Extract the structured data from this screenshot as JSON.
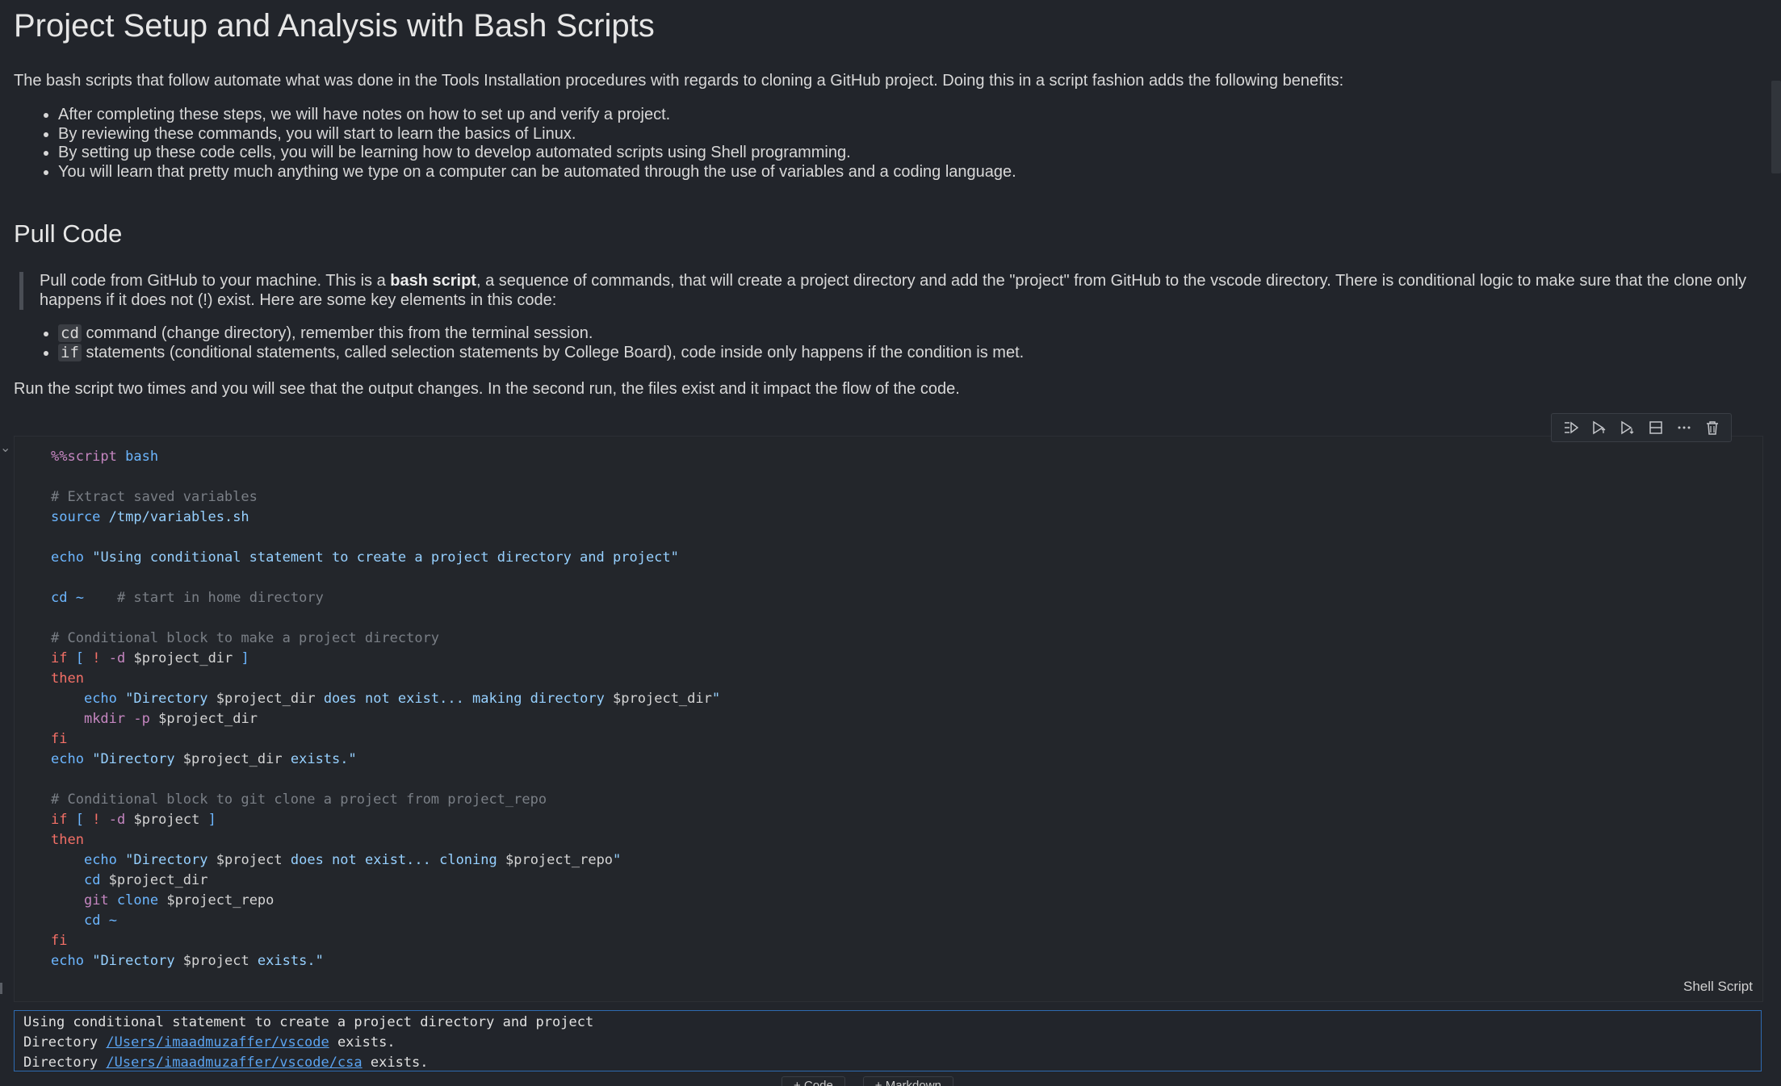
{
  "title": "Project Setup and Analysis with Bash Scripts",
  "intro": "The bash scripts that follow automate what was done in the Tools Installation procedures with regards to cloning a GitHub project. Doing this in a script fashion adds the following benefits:",
  "benefits": [
    "After completing these steps, we will have notes on how to set up and verify a project.",
    "By reviewing these commands, you will start to learn the basics of Linux.",
    "By setting up these code cells, you will be learning how to develop automated scripts using Shell programming.",
    "You will learn that pretty much anything we type on a computer can be automated through the use of variables and a coding language."
  ],
  "section_heading": "Pull Code",
  "quote": {
    "before": "Pull code from GitHub to your machine. This is a ",
    "bold": "bash script",
    "after": ", a sequence of commands, that will create a project directory and add the \"project\" from GitHub to the vscode directory. There is conditional logic to make sure that the clone only happens if it does not (!) exist. Here are some key elements in this code:"
  },
  "key_elements": [
    {
      "code": "cd",
      "text": " command (change directory), remember this from the terminal session."
    },
    {
      "code": "if",
      "text": " statements (conditional statements, called selection statements by College Board), code inside only happens if the condition is met."
    }
  ],
  "run_note": "Run the script two times and you will see that the output changes. In the second run, the files exist and it impact the flow of the code.",
  "cell": {
    "language": "Shell Script",
    "toolbar_icons": [
      "run-by-line-icon",
      "run-above-icon",
      "run-below-icon",
      "split-cell-icon",
      "more-icon",
      "delete-icon"
    ]
  },
  "output": {
    "line1": "Using conditional statement to create a project directory and project",
    "line2_prefix": "Directory ",
    "line2_link": "/Users/imaadmuzaffer/vscode",
    "line2_suffix": " exists.",
    "line3_prefix": "Directory ",
    "line3_link": "/Users/imaadmuzaffer/vscode/csa",
    "line3_suffix": " exists."
  },
  "add_buttons": [
    "+ Code",
    "+ Markdown"
  ]
}
